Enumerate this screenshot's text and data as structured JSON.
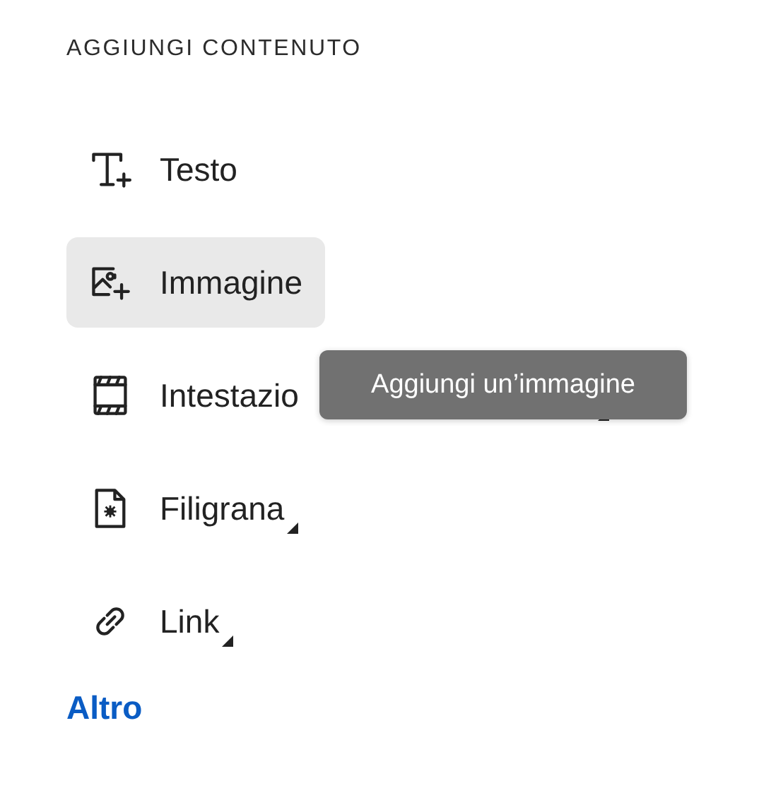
{
  "heading": "AGGIUNGI CONTENUTO",
  "items": [
    {
      "kind": "text",
      "label": "Testo",
      "selected": false,
      "has_menu": false
    },
    {
      "kind": "image",
      "label": "Immagine",
      "selected": true,
      "has_menu": false
    },
    {
      "kind": "header",
      "label": "Intestazio",
      "selected": false,
      "has_menu": true
    },
    {
      "kind": "watermark",
      "label": "Filigrana",
      "selected": false,
      "has_menu": true
    },
    {
      "kind": "link",
      "label": "Link",
      "selected": false,
      "has_menu": true
    }
  ],
  "more_link": "Altro",
  "tooltip": "Aggiungi un’immagine"
}
